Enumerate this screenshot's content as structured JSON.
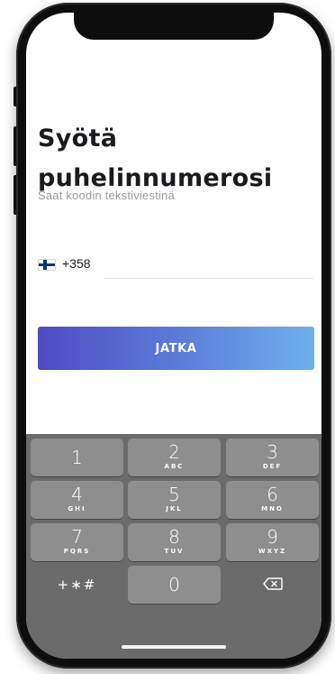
{
  "header": {
    "title": "Syötä puhelinnumerosi",
    "subtitle": "Saat koodin tekstiviestinä"
  },
  "phone_input": {
    "country_flag_icon": "finland-flag-icon",
    "country_code": "+358",
    "value": "",
    "placeholder": ""
  },
  "actions": {
    "continue_label": "JATKA"
  },
  "colors": {
    "button_gradient_start": "#4f4bc2",
    "button_gradient_end": "#6eb0ee",
    "keyboard_background": "#6b6b6b",
    "key_background": "#8e8e8e"
  },
  "keypad": {
    "keys": [
      {
        "digit": "1",
        "letters": ""
      },
      {
        "digit": "2",
        "letters": "ABC"
      },
      {
        "digit": "3",
        "letters": "DEF"
      },
      {
        "digit": "4",
        "letters": "GHI"
      },
      {
        "digit": "5",
        "letters": "JKL"
      },
      {
        "digit": "6",
        "letters": "MNO"
      },
      {
        "digit": "7",
        "letters": "PQRS"
      },
      {
        "digit": "8",
        "letters": "TUV"
      },
      {
        "digit": "9",
        "letters": "WXYZ"
      },
      {
        "digit": "0",
        "letters": ""
      }
    ],
    "symbols_label": "+∗#",
    "backspace_icon": "backspace-icon"
  }
}
